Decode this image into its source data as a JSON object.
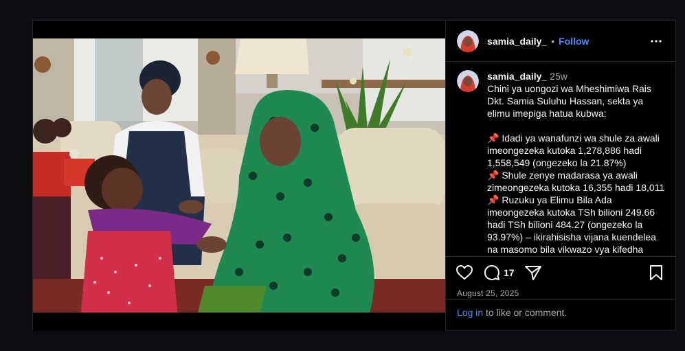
{
  "post": {
    "username": "samia_daily_",
    "follow_label": "Follow",
    "separator": "•",
    "age": "25w",
    "caption_intro": "Chini ya uongozi wa Mheshimiwa Rais Dkt. Samia Suluhu Hassan, sekta ya elimu imepiga hatua kubwa:",
    "bullet_icon": "pushpin",
    "bullets": [
      "Idadi ya wanafunzi wa shule za awali imeongezeka kutoka 1,278,886 hadi 1,558,549 (ongezeko la 21.87%)",
      "Shule zenye madarasa ya awali zimeongezeka kutoka 16,355 hadi 18,011",
      "Ruzuku ya Elimu Bila Ada imeongezeka kutoka TSh bilioni 249.66 hadi TSh bilioni 484.27 (ongezeko la 93.97%) – ikirahisisha vijana kuendelea na masomo bila vikwazo vya kifedha"
    ],
    "comment_count": "17",
    "date": "August 25, 2025"
  },
  "login": {
    "link": "Log in",
    "rest": " to like or comment."
  },
  "icons": {
    "like": "heart-outline",
    "comment": "speech-bubble",
    "share": "paper-plane",
    "save": "bookmark-outline",
    "more": "three-dots"
  },
  "colors": {
    "background": "#0c0e12",
    "panel": "#000000",
    "text": "#f5f5f5",
    "muted": "#a8a8a8",
    "link": "#4a8dff",
    "border": "#262626"
  }
}
